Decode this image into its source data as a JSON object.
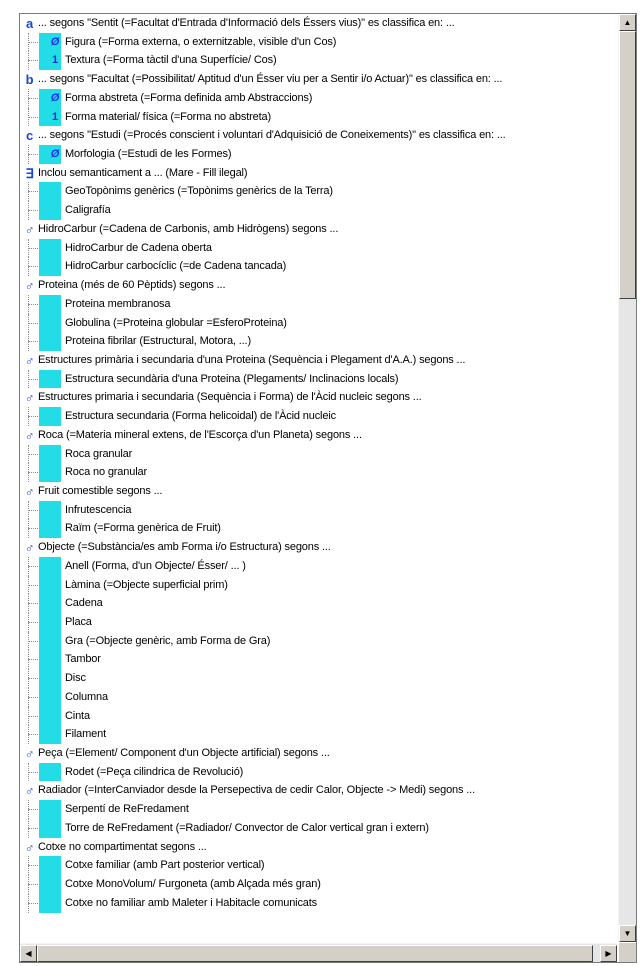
{
  "rows": [
    {
      "kind": "top",
      "icon": "a",
      "icon_name": "letter-a-icon",
      "text": "... segons \"Sentit (=Facultat d'Entrada d'Informació dels Éssers vius)\" es classifica en: ..."
    },
    {
      "kind": "child",
      "badge": "Ø",
      "badge_name": "empty-set-icon",
      "text": "Figura (=Forma externa, o externitzable, visible d'un Cos)"
    },
    {
      "kind": "child",
      "badge": "1",
      "badge_name": "number-one-icon",
      "text": "Textura (=Forma tàctil d'una Superfície/ Cos)"
    },
    {
      "kind": "top",
      "icon": "b",
      "icon_name": "letter-b-icon",
      "text": "... segons \"Facultat (=Possibilitat/ Aptitud d'un Ésser viu per a Sentir i/o Actuar)\" es classifica en: ..."
    },
    {
      "kind": "child",
      "badge": "Ø",
      "badge_name": "empty-set-icon",
      "text": "Forma abstreta (=Forma definida amb Abstraccions)"
    },
    {
      "kind": "child",
      "badge": "1",
      "badge_name": "number-one-icon",
      "text": "Forma material/ física (=Forma no abstreta)"
    },
    {
      "kind": "top",
      "icon": "c",
      "icon_name": "letter-c-icon",
      "text": "... segons \"Estudi (=Procés conscient i voluntari d'Adquisició de Coneixements)\" es classifica en: ..."
    },
    {
      "kind": "child",
      "badge": "Ø",
      "badge_name": "empty-set-icon",
      "text": "Morfologia (=Estudi de les Formes)"
    },
    {
      "kind": "top",
      "icon": "∃",
      "icon_name": "exists-icon",
      "text": "Inclou semanticament a ...  (Mare - Fill ilegal)"
    },
    {
      "kind": "child",
      "text": "GeoTopònims genèrics (=Topònims genèrics de la Terra)"
    },
    {
      "kind": "child",
      "text": "Caligrafía"
    },
    {
      "kind": "top",
      "icon": "♂",
      "icon_name": "male-symbol-icon",
      "text": "HidroCarbur (=Cadena de Carbonis, amb Hidrògens) segons ..."
    },
    {
      "kind": "child",
      "text": "HidroCarbur de Cadena oberta"
    },
    {
      "kind": "child",
      "text": "HidroCarbur carbocíclic (=de Cadena tancada)"
    },
    {
      "kind": "top",
      "icon": "♂",
      "icon_name": "male-symbol-icon",
      "text": "Proteina (més de 60 Pèptids) segons ..."
    },
    {
      "kind": "child",
      "text": "Proteina membranosa"
    },
    {
      "kind": "child",
      "text": "Globulina (=Proteina globular =EsferoProteina)"
    },
    {
      "kind": "child",
      "text": "Proteina fibrilar (Estructural, Motora, ...)"
    },
    {
      "kind": "top",
      "icon": "♂",
      "icon_name": "male-symbol-icon",
      "text": "Estructures primària i secundaria d'una Proteina (Sequència i Plegament d'A.A.) segons ..."
    },
    {
      "kind": "child",
      "text": "Estructura secundària d'una Proteina (Plegaments/ Inclinacions locals)"
    },
    {
      "kind": "top",
      "icon": "♂",
      "icon_name": "male-symbol-icon",
      "text": "Estructures primaria i secundaria (Sequència i Forma) de l'Àcid nucleic segons ..."
    },
    {
      "kind": "child",
      "text": "Estructura secundaria (Forma helicoidal) de l'Àcid nucleic"
    },
    {
      "kind": "top",
      "icon": "♂",
      "icon_name": "male-symbol-icon",
      "text": "Roca (=Materia mineral extens, de l'Escorça d'un Planeta) segons ..."
    },
    {
      "kind": "child",
      "text": "Roca granular"
    },
    {
      "kind": "child",
      "text": "Roca no granular"
    },
    {
      "kind": "top",
      "icon": "♂",
      "icon_name": "male-symbol-icon",
      "text": "Fruit comestible segons ..."
    },
    {
      "kind": "child",
      "text": "Infrutescencia"
    },
    {
      "kind": "child",
      "text": "Raïm (=Forma genèrica de Fruit)"
    },
    {
      "kind": "top",
      "icon": "♂",
      "icon_name": "male-symbol-icon",
      "text": "Objecte (=Substància/es amb Forma i/o Estructura) segons ..."
    },
    {
      "kind": "child",
      "text": "Anell (Forma, d'un Objecte/ Ésser/ ... )"
    },
    {
      "kind": "child",
      "text": "Làmina (=Objecte superficial prim)"
    },
    {
      "kind": "child",
      "text": "Cadena"
    },
    {
      "kind": "child",
      "text": "Placa"
    },
    {
      "kind": "child",
      "text": "Gra (=Objecte genèric, amb Forma de Gra)"
    },
    {
      "kind": "child",
      "text": "Tambor"
    },
    {
      "kind": "child",
      "text": "Disc"
    },
    {
      "kind": "child",
      "text": "Columna"
    },
    {
      "kind": "child",
      "text": "Cinta"
    },
    {
      "kind": "child",
      "text": "Filament"
    },
    {
      "kind": "top",
      "icon": "♂",
      "icon_name": "male-symbol-icon",
      "text": "Peça (=Element/ Component d'un Objecte artificial) segons ..."
    },
    {
      "kind": "child",
      "text": "Rodet (=Peça cilindrica de Revolució)"
    },
    {
      "kind": "top",
      "icon": "♂",
      "icon_name": "male-symbol-icon",
      "text": "Radiador (=InterCanviador desde la Persepectiva de cedir Calor, Objecte -> Medi) segons ..."
    },
    {
      "kind": "child",
      "text": "Serpentí de ReFredament"
    },
    {
      "kind": "child",
      "text": "Torre de ReFredament (=Radiador/ Convector de Calor vertical gran i extern)"
    },
    {
      "kind": "top",
      "icon": "♂",
      "icon_name": "male-symbol-icon",
      "text": "Cotxe no compartimentat segons ..."
    },
    {
      "kind": "child",
      "text": "Cotxe familiar (amb Part posterior vertical)"
    },
    {
      "kind": "child",
      "text": "Cotxe MonoVolum/ Furgoneta (amb Alçada més gran)"
    },
    {
      "kind": "child",
      "text": "Cotxe no familiar amb Maleter i Habitacle comunicats"
    }
  ],
  "scrollbar": {
    "up_glyph": "▲",
    "down_glyph": "▼",
    "left_glyph": "◀",
    "right_glyph": "▶",
    "vertical_position": 0.0
  },
  "colors": {
    "accent_bar": "#22dde6",
    "icon_blue": "#1747d3"
  }
}
